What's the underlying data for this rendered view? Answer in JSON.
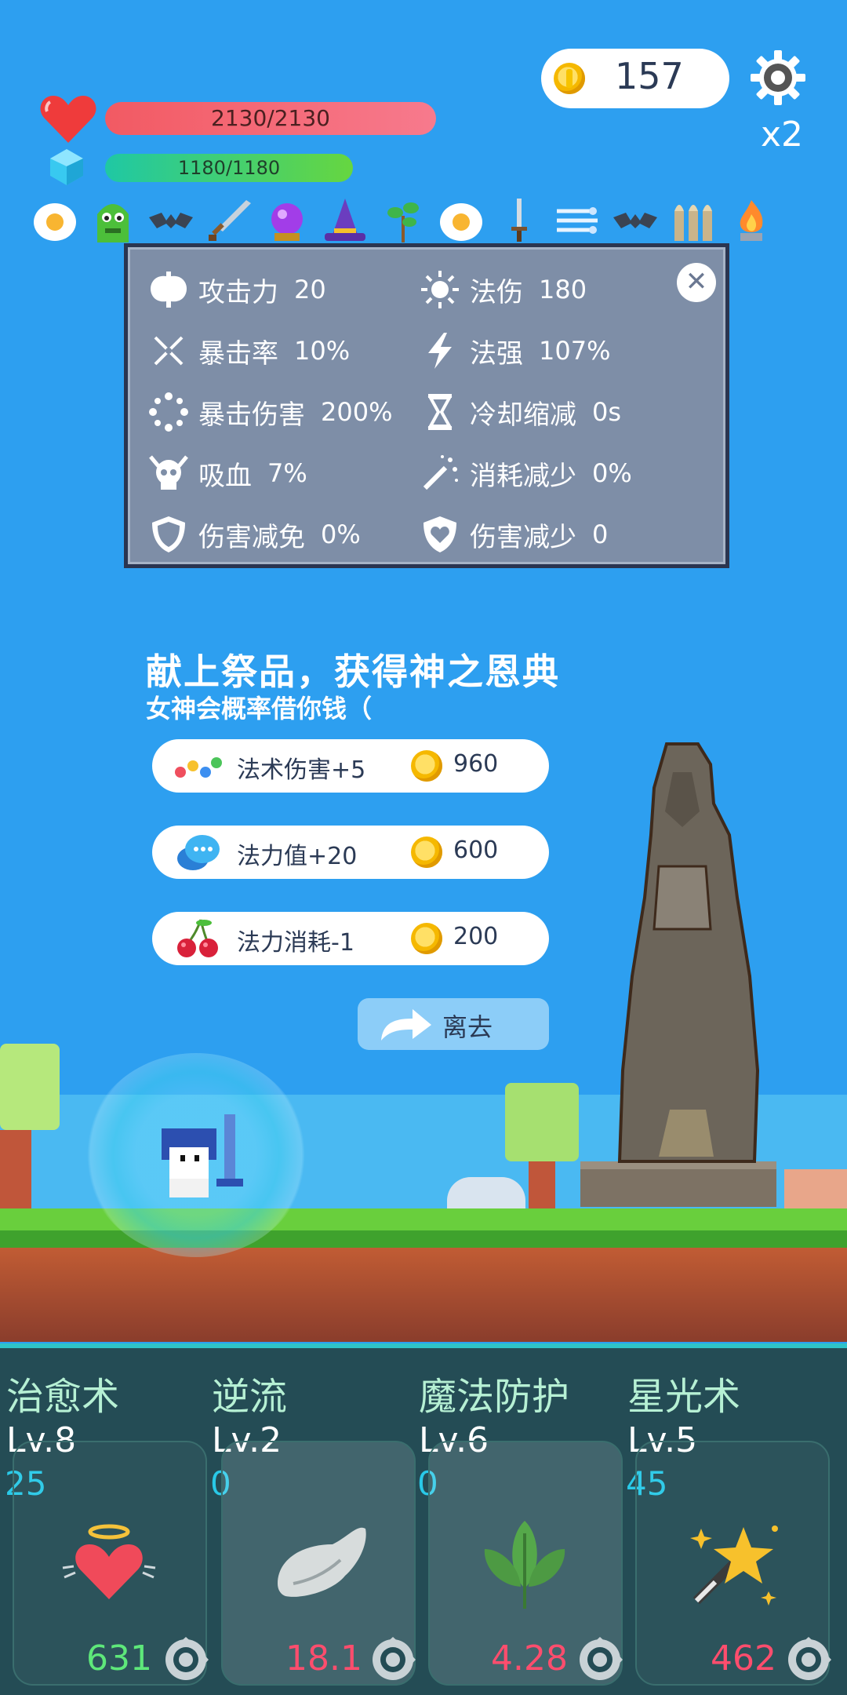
{
  "hud": {
    "coins": "157",
    "speed": "x2",
    "hp_text": "2130/2130",
    "mp_text": "1180/1180"
  },
  "buff_icons": [
    "egg-icon",
    "slime-icon",
    "bat-icon",
    "sword-icon",
    "crystal-ball-icon",
    "wizard-hat-icon",
    "sapling-icon",
    "egg-icon",
    "dagger-icon",
    "wind-icon",
    "bat-icon",
    "bullets-icon",
    "flame-icon"
  ],
  "stats": {
    "left": [
      {
        "label": "攻击力",
        "value": "20",
        "icon": "axe-icon"
      },
      {
        "label": "暴击率",
        "value": "10%",
        "icon": "crossed-swords-icon"
      },
      {
        "label": "暴击伤害",
        "value": "200%",
        "icon": "burst-icon"
      },
      {
        "label": "吸血",
        "value": "7%",
        "icon": "skull-icon"
      },
      {
        "label": "伤害减免",
        "value": "0%",
        "icon": "shield-icon"
      }
    ],
    "right": [
      {
        "label": "法伤",
        "value": "180",
        "icon": "sun-icon"
      },
      {
        "label": "法强",
        "value": "107%",
        "icon": "lightning-icon"
      },
      {
        "label": "冷却缩减",
        "value": "0s",
        "icon": "hourglass-icon"
      },
      {
        "label": "消耗减少",
        "value": "0%",
        "icon": "magic-wand-icon"
      },
      {
        "label": "伤害减少",
        "value": "0",
        "icon": "heart-shield-icon"
      }
    ]
  },
  "offering": {
    "title": "献上祭品，获得神之恩典",
    "subtitle": "女神会概率借你钱（",
    "options": [
      {
        "label": "法术伤害+5",
        "cost": "960",
        "icon": "dots-icon"
      },
      {
        "label": "法力值+20",
        "cost": "600",
        "icon": "chat-bubble-icon"
      },
      {
        "label": "法力消耗-1",
        "cost": "200",
        "icon": "cherry-icon"
      }
    ],
    "leave_label": "离去"
  },
  "skills": [
    {
      "name": "治愈术",
      "level": "Lv.8",
      "cost": "25",
      "value": "631",
      "value_color": "#5ee87a",
      "icon": "angel-heart-icon"
    },
    {
      "name": "逆流",
      "level": "Lv.2",
      "cost": "0",
      "value": "18.1",
      "value_color": "#ff4d6d",
      "icon": "wing-icon"
    },
    {
      "name": "魔法防护",
      "level": "Lv.6",
      "cost": "0",
      "value": "4.28",
      "value_color": "#ff4d6d",
      "icon": "leaf-icon"
    },
    {
      "name": "星光术",
      "level": "Lv.5",
      "cost": "45",
      "value": "462",
      "value_color": "#ff4d6d",
      "icon": "star-wand-icon"
    }
  ]
}
